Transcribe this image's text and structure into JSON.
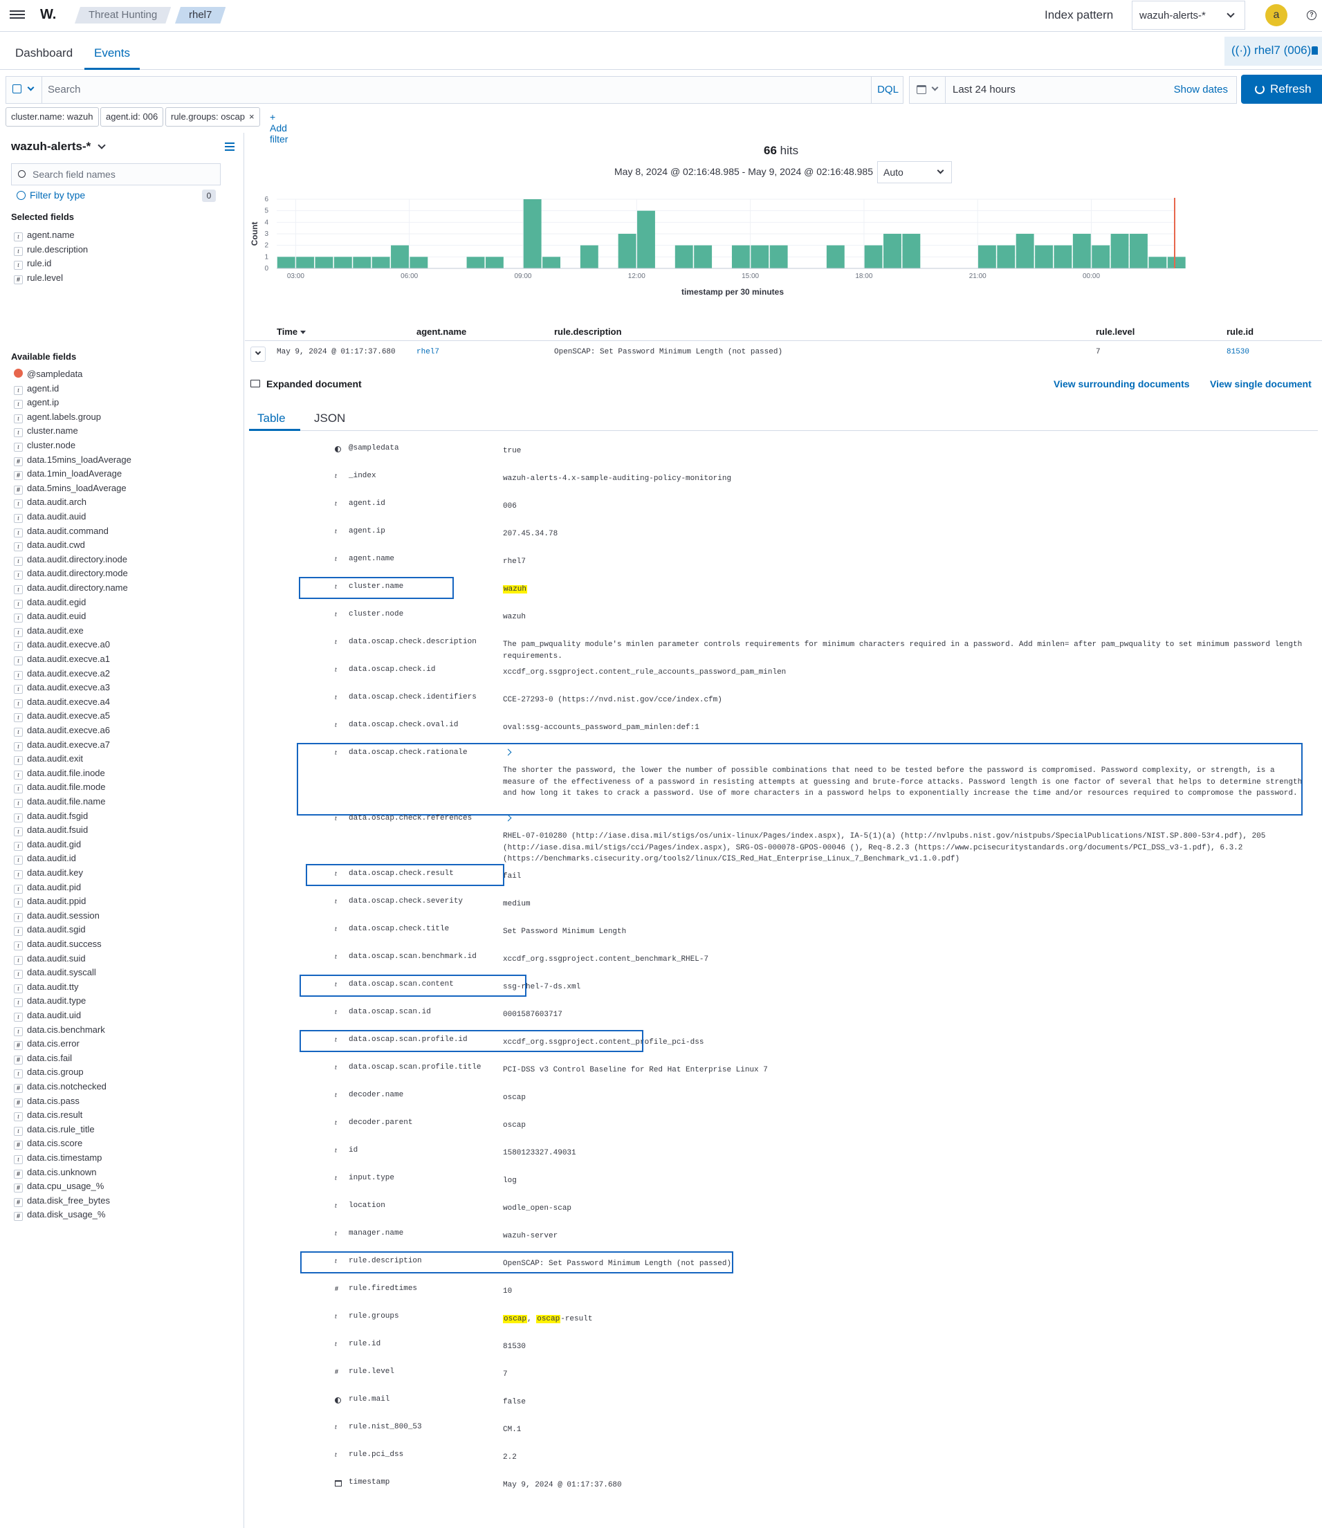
{
  "header": {
    "logo": "W.",
    "breadcrumbs": [
      "Threat Hunting",
      "rhel7"
    ],
    "index_pattern_label": "Index pattern",
    "index_pattern_value": "wazuh-alerts-*",
    "avatar_letter": "a",
    "help_glyph": "?"
  },
  "tabs": {
    "dashboard": "Dashboard",
    "events": "Events",
    "agent_badge": "rhel7 (006)"
  },
  "query": {
    "placeholder": "Search",
    "language": "DQL",
    "date_range": "Last 24 hours",
    "show_dates": "Show dates",
    "refresh": "Refresh"
  },
  "filters": {
    "pills": [
      "cluster.name: wazuh",
      "agent.id: 006",
      "rule.groups: oscap"
    ],
    "close_glyph": "×",
    "add_filter": "+ Add filter"
  },
  "sidebar": {
    "index_pattern": "wazuh-alerts-*",
    "search_placeholder": "Search field names",
    "filter_by_type": "Filter by type",
    "filter_count": "0",
    "selected_heading": "Selected fields",
    "selected": [
      {
        "name": "agent.name",
        "type": "t"
      },
      {
        "name": "rule.description",
        "type": "t"
      },
      {
        "name": "rule.id",
        "type": "t"
      },
      {
        "name": "rule.level",
        "type": "#"
      }
    ],
    "available_heading": "Available fields",
    "available": [
      {
        "name": "@sampledata",
        "type": "s"
      },
      {
        "name": "agent.id",
        "type": "t"
      },
      {
        "name": "agent.ip",
        "type": "t"
      },
      {
        "name": "agent.labels.group",
        "type": "t"
      },
      {
        "name": "cluster.name",
        "type": "t"
      },
      {
        "name": "cluster.node",
        "type": "t"
      },
      {
        "name": "data.15mins_loadAverage",
        "type": "#"
      },
      {
        "name": "data.1min_loadAverage",
        "type": "#"
      },
      {
        "name": "data.5mins_loadAverage",
        "type": "#"
      },
      {
        "name": "data.audit.arch",
        "type": "t"
      },
      {
        "name": "data.audit.auid",
        "type": "t"
      },
      {
        "name": "data.audit.command",
        "type": "t"
      },
      {
        "name": "data.audit.cwd",
        "type": "t"
      },
      {
        "name": "data.audit.directory.inode",
        "type": "t"
      },
      {
        "name": "data.audit.directory.mode",
        "type": "t"
      },
      {
        "name": "data.audit.directory.name",
        "type": "t"
      },
      {
        "name": "data.audit.egid",
        "type": "t"
      },
      {
        "name": "data.audit.euid",
        "type": "t"
      },
      {
        "name": "data.audit.exe",
        "type": "t"
      },
      {
        "name": "data.audit.execve.a0",
        "type": "t"
      },
      {
        "name": "data.audit.execve.a1",
        "type": "t"
      },
      {
        "name": "data.audit.execve.a2",
        "type": "t"
      },
      {
        "name": "data.audit.execve.a3",
        "type": "t"
      },
      {
        "name": "data.audit.execve.a4",
        "type": "t"
      },
      {
        "name": "data.audit.execve.a5",
        "type": "t"
      },
      {
        "name": "data.audit.execve.a6",
        "type": "t"
      },
      {
        "name": "data.audit.execve.a7",
        "type": "t"
      },
      {
        "name": "data.audit.exit",
        "type": "t"
      },
      {
        "name": "data.audit.file.inode",
        "type": "t"
      },
      {
        "name": "data.audit.file.mode",
        "type": "t"
      },
      {
        "name": "data.audit.file.name",
        "type": "t"
      },
      {
        "name": "data.audit.fsgid",
        "type": "t"
      },
      {
        "name": "data.audit.fsuid",
        "type": "t"
      },
      {
        "name": "data.audit.gid",
        "type": "t"
      },
      {
        "name": "data.audit.id",
        "type": "t"
      },
      {
        "name": "data.audit.key",
        "type": "t"
      },
      {
        "name": "data.audit.pid",
        "type": "t"
      },
      {
        "name": "data.audit.ppid",
        "type": "t"
      },
      {
        "name": "data.audit.session",
        "type": "t"
      },
      {
        "name": "data.audit.sgid",
        "type": "t"
      },
      {
        "name": "data.audit.success",
        "type": "t"
      },
      {
        "name": "data.audit.suid",
        "type": "t"
      },
      {
        "name": "data.audit.syscall",
        "type": "t"
      },
      {
        "name": "data.audit.tty",
        "type": "t"
      },
      {
        "name": "data.audit.type",
        "type": "t"
      },
      {
        "name": "data.audit.uid",
        "type": "t"
      },
      {
        "name": "data.cis.benchmark",
        "type": "t"
      },
      {
        "name": "data.cis.error",
        "type": "#"
      },
      {
        "name": "data.cis.fail",
        "type": "#"
      },
      {
        "name": "data.cis.group",
        "type": "t"
      },
      {
        "name": "data.cis.notchecked",
        "type": "#"
      },
      {
        "name": "data.cis.pass",
        "type": "#"
      },
      {
        "name": "data.cis.result",
        "type": "t"
      },
      {
        "name": "data.cis.rule_title",
        "type": "t"
      },
      {
        "name": "data.cis.score",
        "type": "#"
      },
      {
        "name": "data.cis.timestamp",
        "type": "t"
      },
      {
        "name": "data.cis.unknown",
        "type": "#"
      },
      {
        "name": "data.cpu_usage_%",
        "type": "#"
      },
      {
        "name": "data.disk_free_bytes",
        "type": "#"
      },
      {
        "name": "data.disk_usage_%",
        "type": "#"
      }
    ]
  },
  "summary": {
    "hits_count": "66",
    "hits_label": " hits",
    "range": "May 8, 2024 @ 02:16:48.985 - May 9, 2024 @ 02:16:48.985",
    "interval": "Auto"
  },
  "chart_data": {
    "type": "bar",
    "xlabel": "timestamp per 30 minutes",
    "ylabel": "Count",
    "ylim": [
      0,
      6
    ],
    "yticks": [
      0,
      1,
      2,
      3,
      4,
      5,
      6
    ],
    "xticks": [
      "03:00",
      "06:00",
      "09:00",
      "12:00",
      "15:00",
      "18:00",
      "21:00",
      "00:00"
    ],
    "start_hour": 2.5,
    "end_hour": 26.2,
    "bar_hours": [
      2.5,
      3,
      3.5,
      4,
      4.5,
      5,
      5.5,
      6,
      7.5,
      8,
      9,
      9.5,
      10.5,
      11.5,
      12,
      13,
      13.5,
      14.5,
      15,
      15.5,
      17,
      18,
      18.5,
      19,
      21,
      21.5,
      22,
      22.5,
      23,
      23.5,
      24,
      24.5,
      25,
      25.5,
      26
    ],
    "values": [
      1,
      1,
      1,
      1,
      1,
      1,
      2,
      1,
      1,
      1,
      6,
      1,
      2,
      3,
      5,
      2,
      2,
      2,
      2,
      2,
      2,
      2,
      3,
      3,
      2,
      2,
      3,
      2,
      2,
      3,
      2,
      3,
      3,
      1,
      1
    ],
    "now_hour": 26.2,
    "bar_color": "#54b399"
  },
  "table": {
    "columns": [
      "Time",
      "agent.name",
      "rule.description",
      "rule.level",
      "rule.id"
    ],
    "row": {
      "time": "May 9, 2024 @ 01:17:37.680",
      "agent_name": "rhel7",
      "rule_description": "OpenSCAP: Set Password Minimum Length (not passed)",
      "rule_level": "7",
      "rule_id": "81530"
    }
  },
  "expanded": {
    "title": "Expanded document",
    "view_surrounding": "View surrounding documents",
    "view_single": "View single document",
    "tab_table": "Table",
    "tab_json": "JSON"
  },
  "doc_fields": [
    {
      "key": "@sampledata",
      "type": "b",
      "value": "true"
    },
    {
      "key": "_index",
      "type": "t",
      "value": "wazuh-alerts-4.x-sample-auditing-policy-monitoring"
    },
    {
      "key": "agent.id",
      "type": "t",
      "value": "006",
      "link": true
    },
    {
      "key": "agent.ip",
      "type": "t",
      "value": "207.45.34.78"
    },
    {
      "key": "agent.name",
      "type": "t",
      "value": "rhel7",
      "link": true
    },
    {
      "key": "cluster.name",
      "type": "t",
      "value": "wazuh",
      "hl_all": true,
      "box": [
        78,
        224
      ]
    },
    {
      "key": "cluster.node",
      "type": "t",
      "value": "wazuh"
    },
    {
      "key": "data.oscap.check.description",
      "type": "t",
      "value": "The pam_pwquality module's minlen parameter controls requirements for minimum characters required in a password. Add minlen= after pam_pwquality to set minimum password length requirements."
    },
    {
      "key": "data.oscap.check.id",
      "type": "t",
      "value": "xccdf_org.ssgproject.content_rule_accounts_password_pam_minlen"
    },
    {
      "key": "data.oscap.check.identifiers",
      "type": "t",
      "value": "CCE-27293-0 (https://nvd.nist.gov/cce/index.cfm)"
    },
    {
      "key": "data.oscap.check.oval.id",
      "type": "t",
      "value": "oval:ssg-accounts_password_pam_minlen:def:1"
    },
    {
      "key": "data.oscap.check.rationale",
      "type": "t",
      "value": "The shorter the password, the lower the number of possible combinations that need to be tested before the password is compromised. Password complexity, or strength, is a measure of the effectiveness of a password in resisting attempts at guessing and brute-force attacks. Password length is one factor of several that helps to determine strength and how long it takes to crack a password. Use of more characters in a password helps to exponentially increase the time and/or resources required to compromose the password.",
      "expand": true,
      "box": [
        75,
        1454
      ]
    },
    {
      "key": "data.oscap.check.references",
      "type": "t",
      "value": "RHEL-07-010280 (http://iase.disa.mil/stigs/os/unix-linux/Pages/index.aspx), IA-5(1)(a) (http://nvlpubs.nist.gov/nistpubs/SpecialPublications/NIST.SP.800-53r4.pdf), 205 (http://iase.disa.mil/stigs/cci/Pages/index.aspx), SRG-OS-000078-GPOS-00046 (), Req-8.2.3 (https://www.pcisecuritystandards.org/documents/PCI_DSS_v3-1.pdf), 6.3.2 (https://benchmarks.cisecurity.org/tools2/linux/CIS_Red_Hat_Enterprise_Linux_7_Benchmark_v1.1.0.pdf)",
      "expand": true
    },
    {
      "key": "data.oscap.check.result",
      "type": "t",
      "value": "fail",
      "box": [
        88,
        287
      ]
    },
    {
      "key": "data.oscap.check.severity",
      "type": "t",
      "value": "medium"
    },
    {
      "key": "data.oscap.check.title",
      "type": "t",
      "value": "Set Password Minimum Length"
    },
    {
      "key": "data.oscap.scan.benchmark.id",
      "type": "t",
      "value": "xccdf_org.ssgproject.content_benchmark_RHEL-7"
    },
    {
      "key": "data.oscap.scan.content",
      "type": "t",
      "value": "ssg-rhel-7-ds.xml",
      "box": [
        79,
        328
      ]
    },
    {
      "key": "data.oscap.scan.id",
      "type": "t",
      "value": "0001587603717"
    },
    {
      "key": "data.oscap.scan.profile.id",
      "type": "t",
      "value": "xccdf_org.ssgproject.content_profile_pci-dss",
      "box": [
        79,
        497
      ]
    },
    {
      "key": "data.oscap.scan.profile.title",
      "type": "t",
      "value": "PCI-DSS v3 Control Baseline for Red Hat Enterprise Linux 7"
    },
    {
      "key": "decoder.name",
      "type": "t",
      "value": "oscap"
    },
    {
      "key": "decoder.parent",
      "type": "t",
      "value": "oscap"
    },
    {
      "key": "id",
      "type": "t",
      "value": "1580123327.49031"
    },
    {
      "key": "input.type",
      "type": "t",
      "value": "log"
    },
    {
      "key": "location",
      "type": "t",
      "value": "wodle_open-scap"
    },
    {
      "key": "manager.name",
      "type": "t",
      "value": "wazuh-server"
    },
    {
      "key": "rule.description",
      "type": "t",
      "value": "OpenSCAP: Set Password Minimum Length (not passed)",
      "box": [
        80,
        626
      ]
    },
    {
      "key": "rule.firedtimes",
      "type": "#",
      "value": "10"
    },
    {
      "key": "rule.groups",
      "type": "t",
      "value": "oscap, oscap-result",
      "hl_word": "oscap"
    },
    {
      "key": "rule.id",
      "type": "t",
      "value": "81530",
      "link": true
    },
    {
      "key": "rule.level",
      "type": "#",
      "value": "7"
    },
    {
      "key": "rule.mail",
      "type": "b",
      "value": "false"
    },
    {
      "key": "rule.nist_800_53",
      "type": "t",
      "value": "CM.1"
    },
    {
      "key": "rule.pci_dss",
      "type": "t",
      "value": "2.2"
    },
    {
      "key": "timestamp",
      "type": "d",
      "value": "May 9, 2024 @ 01:17:37.680"
    }
  ]
}
